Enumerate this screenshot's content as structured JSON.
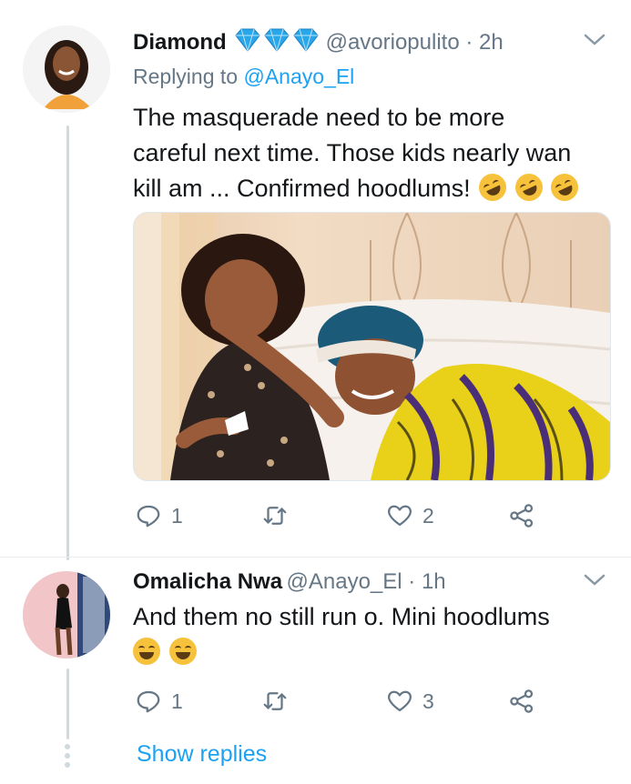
{
  "tweet1": {
    "display_name": "Diamond",
    "badge_emoji": "💎💎💎",
    "handle": "@avoriopulito",
    "separator": " · ",
    "time": "2h",
    "replying_prefix": "Replying to ",
    "replying_to": "@Anayo_El",
    "text_line1": "The masquerade need to be more",
    "text_line2": "careful next time.  Those kids nearly wan",
    "text_line3": "kill am ... Confirmed hoodlums!",
    "text_emoji_count": 3,
    "actions": {
      "replies": "1",
      "retweets": "",
      "likes": "2"
    },
    "media_alt": "photo"
  },
  "tweet2": {
    "display_name": "Omalicha Nwa",
    "handle": "@Anayo_El",
    "separator": " · ",
    "time": "1h",
    "text_line1": "And them no still run o. Mini hoodlums",
    "text_emoji_count": 2,
    "actions": {
      "replies": "1",
      "retweets": "",
      "likes": "3"
    }
  },
  "show_replies_label": "Show replies",
  "colors": {
    "accent": "#1da1f2",
    "secondary_text": "#657786",
    "primary_text": "#14171a",
    "thread_line": "#cfd9de"
  },
  "icons": [
    "reply-icon",
    "retweet-icon",
    "like-icon",
    "share-icon",
    "chevron-down-icon",
    "diamond-icon",
    "laughing-emoji"
  ]
}
